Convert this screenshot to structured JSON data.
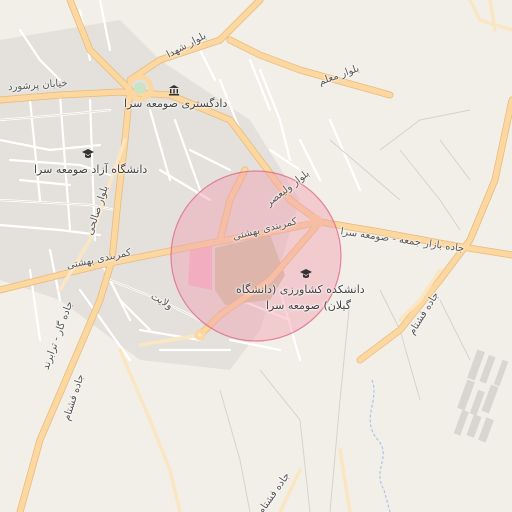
{
  "map": {
    "colors": {
      "background": "#f2efe9",
      "major_road": "#fcd79f",
      "major_road_casing": "#e8b97a",
      "minor_road": "#ffffff",
      "campus": "#cdc6a8",
      "pink_area": "#f5b8d0",
      "radius_fill": "#f2a0b0",
      "radius_stroke": "#e05a7a",
      "water": "#a9c5e8",
      "built_block": "#d9d6d1"
    },
    "labels": {
      "khiaban_pirshoord": "خیابان پرشورد",
      "bolvar_shohada": "بلوار شهدا",
      "bolvar_moallem": "بلوار معلم",
      "dadgostari": "دادگستری صومعه سرا",
      "azad_university": "دانشگاه آزاد صومعه سرا",
      "bolvar_salehi": "بلوار صالحی",
      "bolvar_valiasr": "بلوار ولیعصر",
      "kamarbandi_1": "کمربندی بهشتی",
      "kamarbandi_2": "کمربندی بهشتی",
      "bazar_jomeh": "جاده بازار جمعه - صومعه سرا",
      "agri_faculty_line1": "دانشکده کشاورزی (دانشگاه",
      "agri_faculty_line2": "گیلان) صومعه سرا",
      "velayat": "ولایت",
      "kar_road": "جاده گار - ترابرند",
      "fashtam_1": "جاده فشتام",
      "fashtam_2": "جاده فشتام",
      "fashtam_3": "جاده فشتام"
    },
    "icons": {
      "courthouse": "courthouse-icon",
      "university": "university-icon",
      "faculty": "university-icon"
    }
  }
}
